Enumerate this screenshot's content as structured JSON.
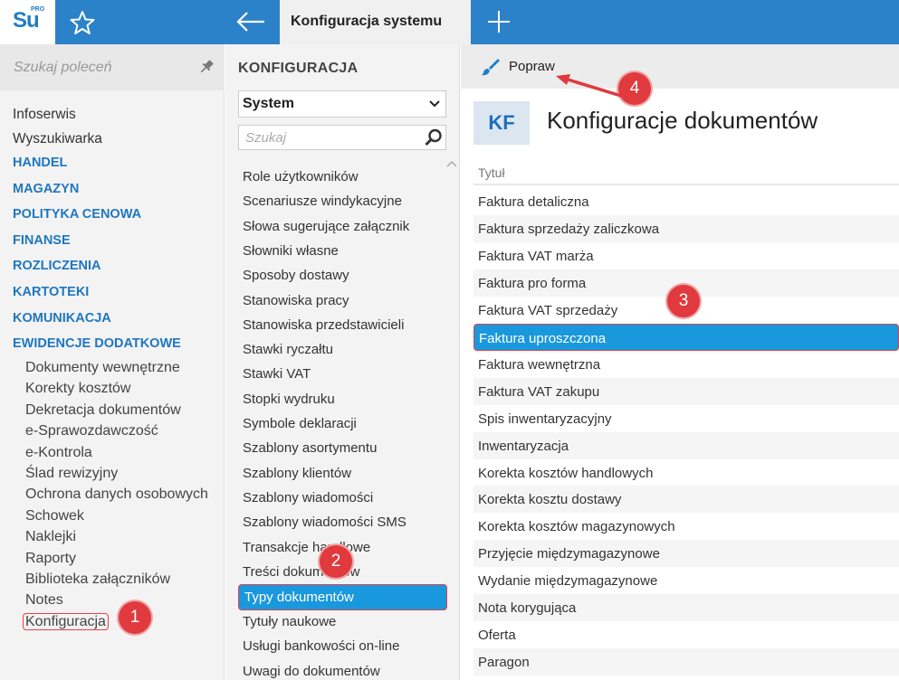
{
  "header": {
    "logo_text": "Su",
    "logo_badge": "PRO",
    "tab_title": "Konfiguracja systemu"
  },
  "left": {
    "search_placeholder": "Szukaj poleceń",
    "items": [
      {
        "label": "Infoserwis",
        "kind": "plain"
      },
      {
        "label": "Wyszukiwarka",
        "kind": "plain"
      },
      {
        "label": "HANDEL",
        "kind": "section"
      },
      {
        "label": "MAGAZYN",
        "kind": "section"
      },
      {
        "label": "POLITYKA CENOWA",
        "kind": "section"
      },
      {
        "label": "FINANSE",
        "kind": "section"
      },
      {
        "label": "ROZLICZENIA",
        "kind": "section"
      },
      {
        "label": "KARTOTEKI",
        "kind": "section"
      },
      {
        "label": "KOMUNIKACJA",
        "kind": "section"
      },
      {
        "label": "EWIDENCJE DODATKOWE",
        "kind": "section"
      }
    ],
    "sub_items": [
      "Dokumenty wewnętrzne",
      "Korekty kosztów",
      "Dekretacja dokumentów",
      "e-Sprawozdawczość",
      "e-Kontrola",
      "Ślad rewizyjny",
      "Ochrona danych osobowych",
      "Schowek",
      "Naklejki",
      "Raporty",
      "Biblioteka załączników",
      "Notes",
      "Konfiguracja"
    ]
  },
  "middle": {
    "title": "KONFIGURACJA",
    "select_value": "System",
    "search_placeholder": "Szukaj",
    "items": [
      "Role użytkowników",
      "Scenariusze windykacyjne",
      "Słowa sugerujące załącznik",
      "Słowniki własne",
      "Sposoby dostawy",
      "Stanowiska pracy",
      "Stanowiska przedstawicieli",
      "Stawki ryczałtu",
      "Stawki VAT",
      "Stopki wydruku",
      "Symbole deklaracji",
      "Szablony asortymentu",
      "Szablony klientów",
      "Szablony wiadomości",
      "Szablony wiadomości SMS",
      "Transakcje handlowe",
      "Treści dokumentów"
    ],
    "selected": "Typy dokumentów",
    "after": [
      "Tytuły naukowe",
      "Usługi bankowości on-line",
      "Uwagi do dokumentów"
    ]
  },
  "right": {
    "toolbar_action": "Popraw",
    "avatar": "KF",
    "title": "Konfiguracje dokumentów",
    "column": "Tytuł",
    "rows": [
      "Faktura detaliczna",
      "Faktura sprzedaży zaliczkowa",
      "Faktura VAT marża",
      "Faktura pro forma",
      "Faktura VAT sprzedaży",
      "Faktura uproszczona",
      "Faktura wewnętrzna",
      "Faktura VAT zakupu",
      "Spis inwentaryzacyjny",
      "Inwentaryzacja",
      "Korekta kosztów handlowych",
      "Korekta kosztu dostawy",
      "Korekta kosztów magazynowych",
      "Przyjęcie międzymagazynowe",
      "Wydanie międzymagazynowe",
      "Nota korygująca",
      "Oferta",
      "Paragon"
    ],
    "selected_row": "Faktura uproszczona"
  },
  "annotations": [
    "1",
    "2",
    "3",
    "4"
  ],
  "colors": {
    "topbar": "#2b82c9",
    "accent": "#1a98dd",
    "highlight": "#e8404a",
    "section": "#1f77c0"
  }
}
